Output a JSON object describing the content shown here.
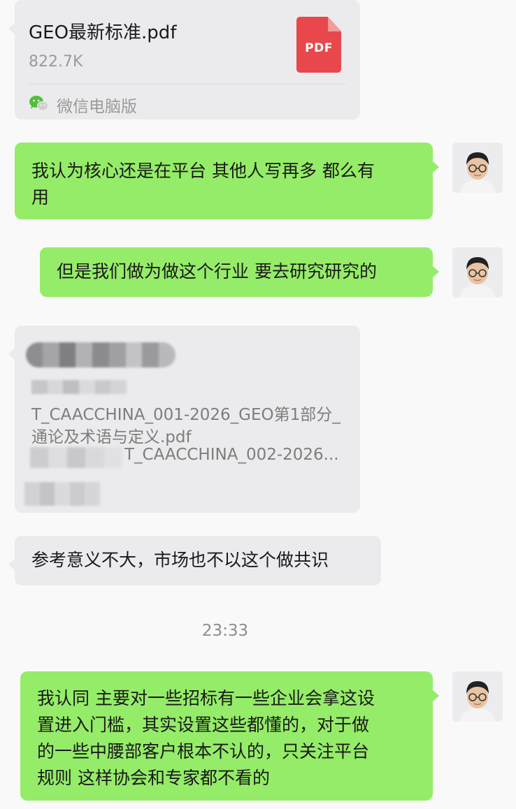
{
  "messages": {
    "file_card": {
      "file_name": "GEO最新标准.pdf",
      "file_size": "822.7K",
      "file_type_label": "PDF",
      "source_label": "微信电脑版",
      "icons": {
        "file": "pdf-file-icon",
        "source": "wechat-icon"
      }
    },
    "msg1": {
      "text_line1": "我认为核心还是在平台 其他人写再多 都么有",
      "text_line2": "用"
    },
    "msg2": {
      "text": "但是我们做为做这个行业 要去研究研究的"
    },
    "forwarded_card": {
      "line1_suffix": "T_CAACCHINA_001-2026_GEO第1部分_",
      "line2": "通论及术语与定义.pdf",
      "line3_suffix": "T_CAACCHINA_002-2026..."
    },
    "msg3": {
      "text": "参考意义不大，市场也不以这个做共识"
    },
    "timestamp": "23:33",
    "msg4": {
      "line1": "我认同 主要对一些招标有一些企业会拿这设",
      "line2": "置进入门槛，其实设置这些都懂的，对于做",
      "line3": "的一些中腰部客户根本不认的，只关注平台",
      "line4": "规则 这样协会和专家都不看的"
    }
  },
  "colors": {
    "outgoing_bubble": "#95ec69",
    "incoming_bubble": "#ebebed",
    "pdf_red": "#e8484b",
    "background": "#f9f9f9"
  }
}
